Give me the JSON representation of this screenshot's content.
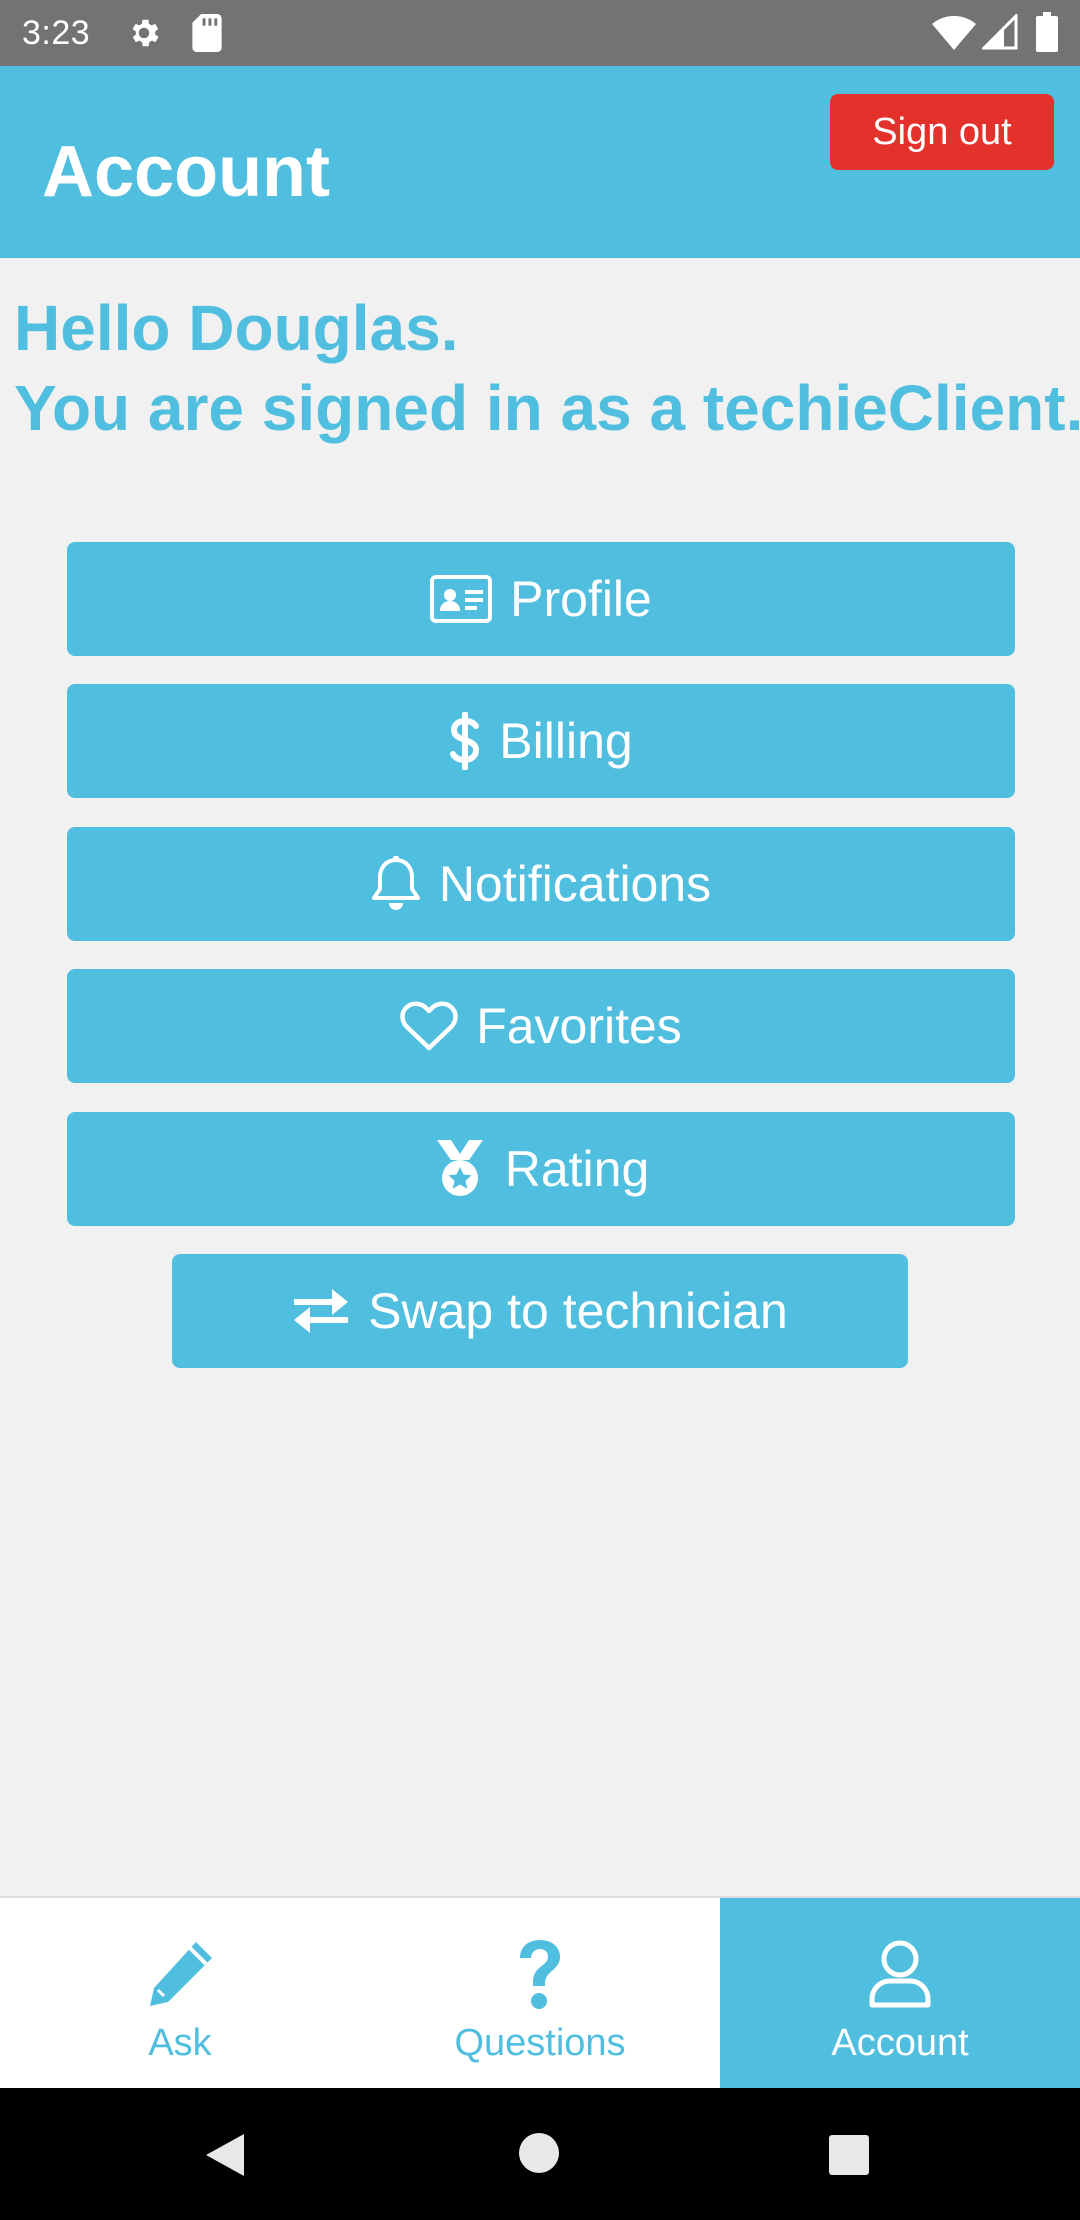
{
  "status_bar": {
    "time": "3:23",
    "icons": [
      "gear-icon",
      "sd-card-icon",
      "wifi-icon",
      "signal-icon",
      "battery-icon"
    ]
  },
  "header": {
    "title": "Account",
    "sign_out_label": "Sign out"
  },
  "greeting": {
    "line1": "Hello Douglas.",
    "line2": "You are signed in as a techieClient."
  },
  "menu": {
    "profile": "Profile",
    "billing": "Billing",
    "notifications": "Notifications",
    "favorites": "Favorites",
    "rating": "Rating",
    "swap": "Swap to technician"
  },
  "bottom_nav": {
    "ask": "Ask",
    "questions": "Questions",
    "account": "Account",
    "active": "account"
  },
  "colors": {
    "primary": "#50bedf",
    "danger": "#e4312c",
    "background": "#f1f1f1",
    "status_bar": "#737373"
  }
}
